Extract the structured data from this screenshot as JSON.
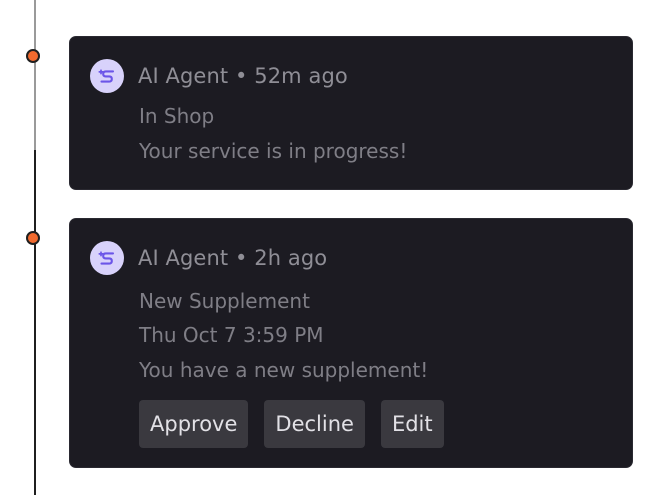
{
  "timeline": {
    "entries": [
      {
        "author": "AI Agent",
        "separator": "•",
        "time": "52m ago",
        "title": "In Shop",
        "message": "Your service is in progress!"
      },
      {
        "author": "AI Agent",
        "separator": "•",
        "time": "2h ago",
        "title": "New Supplement",
        "date": "Thu Oct 7 3:59 PM",
        "message": "You have a new supplement!",
        "actions": {
          "approve": "Approve",
          "decline": "Decline",
          "edit": "Edit"
        }
      }
    ]
  },
  "colors": {
    "card_background": "#1c1b22",
    "timeline_dot": "#f26a2e",
    "avatar_background": "#d8d2fb",
    "avatar_icon": "#6b55e8",
    "button_background": "#3a393f"
  },
  "icons": {
    "avatar": "sparkle-agent-icon"
  }
}
